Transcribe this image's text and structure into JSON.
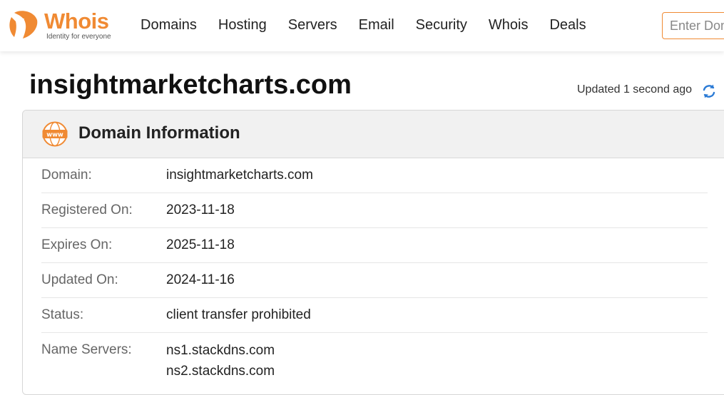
{
  "header": {
    "logo_text": "Whois",
    "logo_tagline": "Identity for everyone",
    "nav": [
      {
        "label": "Domains"
      },
      {
        "label": "Hosting"
      },
      {
        "label": "Servers"
      },
      {
        "label": "Email"
      },
      {
        "label": "Security"
      },
      {
        "label": "Whois"
      },
      {
        "label": "Deals"
      }
    ],
    "search_placeholder": "Enter Domain"
  },
  "main": {
    "domain_title": "insightmarketcharts.com",
    "updated_text": "Updated 1 second ago"
  },
  "card": {
    "title": "Domain Information",
    "icon": "www-icon",
    "rows": [
      {
        "label": "Domain:",
        "value": "insightmarketcharts.com"
      },
      {
        "label": "Registered On:",
        "value": "2023-11-18"
      },
      {
        "label": "Expires On:",
        "value": "2025-11-18"
      },
      {
        "label": "Updated On:",
        "value": "2024-11-16"
      },
      {
        "label": "Status:",
        "value": "client transfer prohibited"
      },
      {
        "label": "Name Servers:",
        "values": [
          "ns1.stackdns.com",
          "ns2.stackdns.com"
        ]
      }
    ]
  },
  "colors": {
    "brand": "#f08a33",
    "refresh": "#2a7ad5"
  }
}
